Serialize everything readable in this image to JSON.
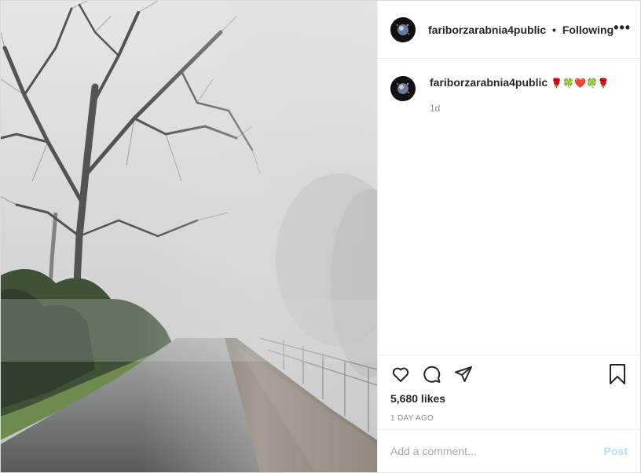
{
  "post": {
    "image_alt": "Foggy path with bare trees",
    "username": "fariborzarabnia4public",
    "separator": "•",
    "follow_status": "Following",
    "more_label": "•••"
  },
  "caption": {
    "username": "fariborzarabnia4public",
    "text": "🌹🍀❤️🍀🌹",
    "timestamp": "1d"
  },
  "actions": {
    "icons": [
      "heart-icon",
      "comment-icon",
      "share-icon",
      "bookmark-icon"
    ],
    "likes": "5,680 likes",
    "posted": "1 DAY AGO"
  },
  "comment_box": {
    "placeholder": "Add a comment...",
    "post_label": "Post"
  },
  "colors": {
    "text": "#262626",
    "muted": "#8e8e8e",
    "border": "#efefef",
    "post_disabled": "#b2dffc"
  }
}
